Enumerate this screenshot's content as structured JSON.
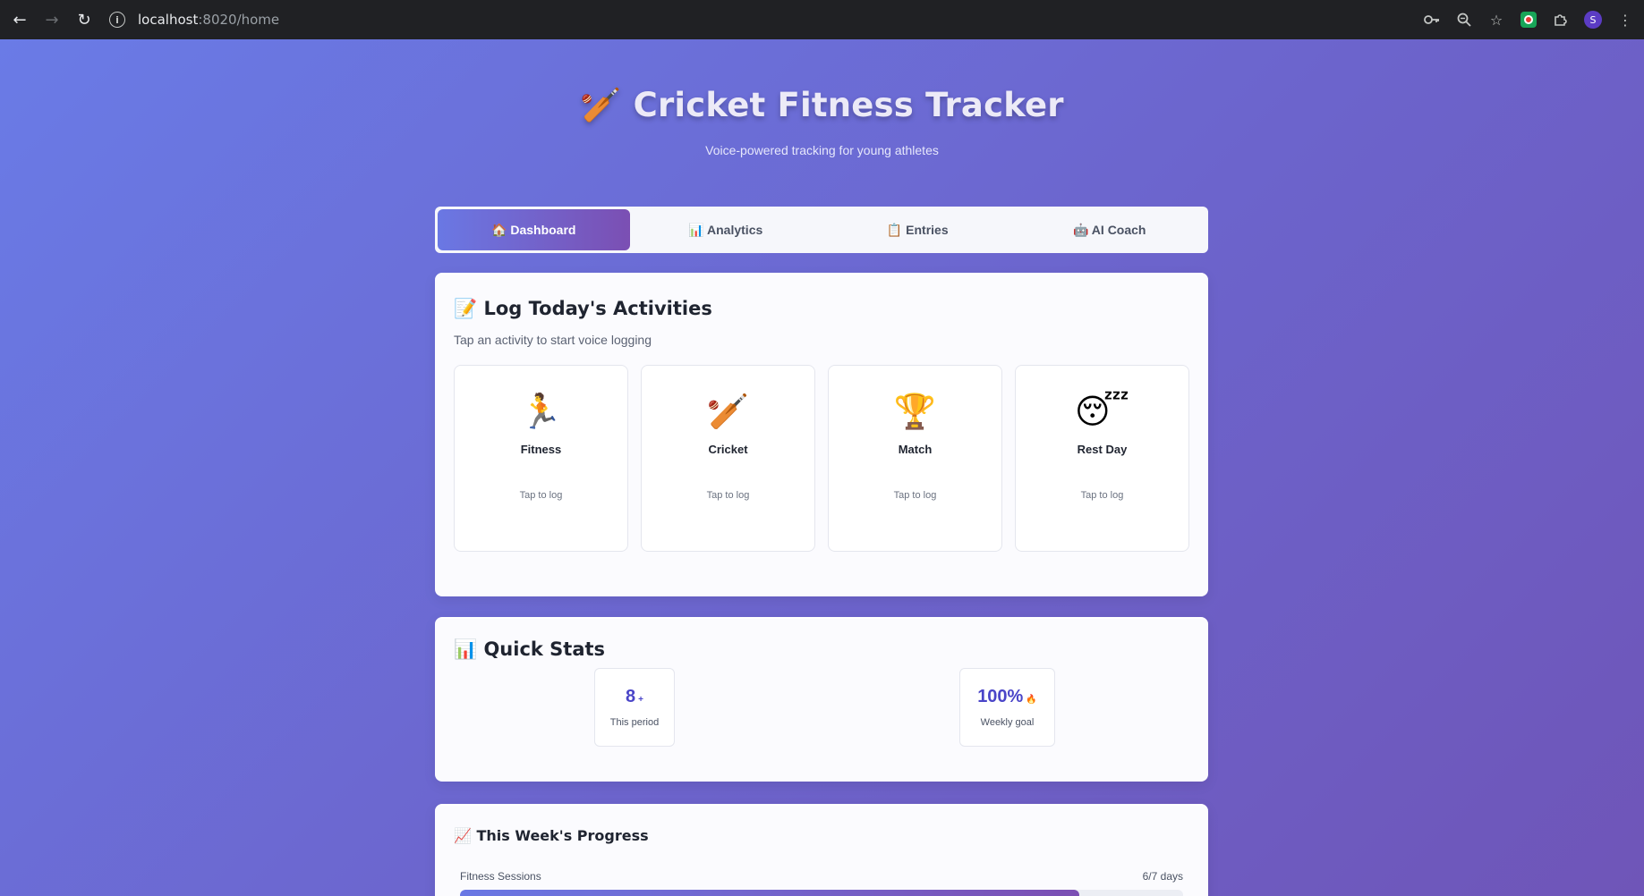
{
  "browser": {
    "url_host": "localhost",
    "url_path": ":8020/home"
  },
  "header": {
    "title": "🏏 Cricket Fitness Tracker",
    "subtitle": "Voice-powered tracking for young athletes"
  },
  "tabs": [
    {
      "label": "🏠 Dashboard",
      "active": true
    },
    {
      "label": "📊 Analytics",
      "active": false
    },
    {
      "label": "📋 Entries",
      "active": false
    },
    {
      "label": "🤖 AI Coach",
      "active": false
    }
  ],
  "log_card": {
    "title": "📝 Log Today's Activities",
    "subtitle": "Tap an activity to start voice logging",
    "activities": [
      {
        "emoji": "🏃",
        "label": "Fitness",
        "hint": "Tap to log"
      },
      {
        "emoji": "🏏",
        "label": "Cricket",
        "hint": "Tap to log"
      },
      {
        "emoji": "🏆",
        "label": "Match",
        "hint": "Tap to log"
      },
      {
        "emoji": "😴",
        "label": "Rest Day",
        "hint": "Tap to log"
      }
    ]
  },
  "stats_card": {
    "title": "📊 Quick Stats",
    "stats": [
      {
        "value": "8",
        "suffix": "+",
        "label": "This period"
      },
      {
        "value": "100%",
        "suffix": "🔥",
        "label": "Weekly goal"
      }
    ]
  },
  "progress_card": {
    "title": "📈 This Week's Progress",
    "items": [
      {
        "label": "Fitness Sessions",
        "value": "6/7 days",
        "fraction": 0.857
      }
    ]
  },
  "colors": {
    "accent_start": "#6a78e4",
    "accent_end": "#7b4fb3",
    "stat_value": "#4a45c8"
  }
}
